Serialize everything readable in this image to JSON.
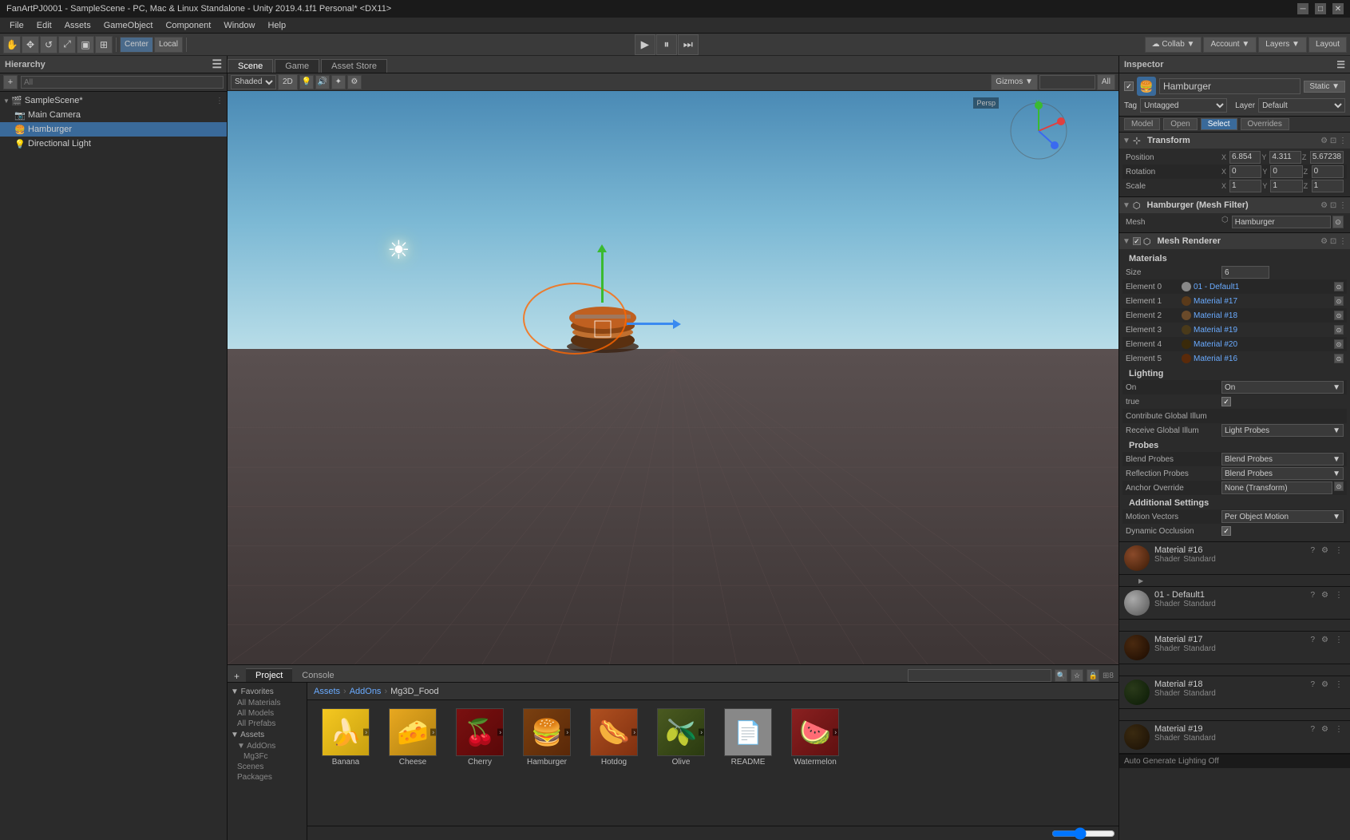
{
  "titleBar": {
    "title": "FanArtPJ0001 - SampleScene - PC, Mac & Linux Standalone - Unity 2019.4.1f1 Personal* <DX11>"
  },
  "menuBar": {
    "items": [
      "File",
      "Edit",
      "Assets",
      "GameObject",
      "Component",
      "Window",
      "Help"
    ]
  },
  "topToolbar": {
    "transformTools": [
      "⬜",
      "✥",
      "↺",
      "⤢",
      "▣",
      "⊞"
    ],
    "centerLocal": [
      "Center",
      "Local"
    ],
    "playPause": [
      "▶",
      "⏸",
      "⏭"
    ],
    "collab": "Collab ▼",
    "account": "Account ▼",
    "layers": "Layers ▼",
    "layout": "Layout"
  },
  "hierarchy": {
    "title": "Hierarchy",
    "searchPlaceholder": "All",
    "scene": "SampleScene*",
    "items": [
      {
        "label": "Main Camera",
        "depth": 1,
        "icon": "camera"
      },
      {
        "label": "Hamburger",
        "depth": 1,
        "icon": "mesh",
        "selected": true
      },
      {
        "label": "Directional Light",
        "depth": 1,
        "icon": "light"
      }
    ]
  },
  "sceneView": {
    "tabs": [
      "Scene",
      "Game",
      "Asset Store"
    ],
    "activeTab": "Scene",
    "shading": "Shaded",
    "gizmos": "Gizmos ▼",
    "allTag": "All"
  },
  "inspector": {
    "title": "Inspector",
    "objectName": "Hamburger",
    "staticLabel": "Static ▼",
    "tagLabel": "Tag",
    "tagValue": "Untagged",
    "layerLabel": "Layer",
    "layerValue": "Default",
    "tabs": [
      "Model",
      "Open",
      "Select",
      "Overrides"
    ],
    "transform": {
      "title": "Transform",
      "position": {
        "x": "6.854",
        "y": "4.311",
        "z": "5.67238"
      },
      "rotation": {
        "x": "0",
        "y": "0",
        "z": "0"
      },
      "scale": {
        "x": "1",
        "y": "1",
        "z": "1"
      }
    },
    "meshFilter": {
      "title": "Hamburger (Mesh Filter)",
      "meshLabel": "Mesh",
      "meshValue": "Hamburger"
    },
    "meshRenderer": {
      "title": "Mesh Renderer",
      "materialsSection": "Materials",
      "sizeLabel": "Size",
      "sizeValue": "6",
      "elements": [
        {
          "label": "Element 0",
          "name": "01 - Default1",
          "color": "#888"
        },
        {
          "label": "Element 1",
          "name": "Material #17",
          "color": "#5a3a1a"
        },
        {
          "label": "Element 2",
          "name": "Material #18",
          "color": "#6a4a2a"
        },
        {
          "label": "Element 3",
          "name": "Material #19",
          "color": "#4a3a1a"
        },
        {
          "label": "Element 4",
          "name": "Material #20",
          "color": "#3a2a0a"
        },
        {
          "label": "Element 5",
          "name": "Material #16",
          "color": "#5a2a0a"
        }
      ],
      "lightingSection": "Lighting",
      "castShadows": "On",
      "receiveShadows": true,
      "contributeGI": "Contribute Global Illum",
      "receiveGI": "Receive Global Illum",
      "receiveGIValue": "Light Probes",
      "probesSection": "Probes",
      "lightProbes": "Blend Probes",
      "reflectionProbes": "Blend Probes",
      "anchorOverride": "None (Transform)",
      "additionalSection": "Additional Settings",
      "motionVectors": "Motion Vectors",
      "motionVectorsValue": "Per Object Motion",
      "dynamicOcclusion": "Dynamic Occlusion"
    }
  },
  "bottomPanel": {
    "tabs": [
      "Project",
      "Console"
    ],
    "activeTab": "Project",
    "breadcrumb": [
      "Assets",
      "AddOns",
      "Mg3D_Food"
    ],
    "searchPlaceholder": "",
    "favorites": {
      "title": "Favorites",
      "items": [
        "All Materials",
        "All Models",
        "All Prefabs"
      ]
    },
    "assetsTree": {
      "title": "Assets",
      "items": [
        "AddOns",
        "Mg3Fc",
        "Scenes",
        "Packages"
      ]
    },
    "gridItems": [
      {
        "name": "Banana",
        "color": "#f5d020",
        "type": "model"
      },
      {
        "name": "Cheese",
        "color": "#f0b040",
        "type": "model"
      },
      {
        "name": "Cherry",
        "color": "#8b0000",
        "type": "model"
      },
      {
        "name": "Hamburger",
        "color": "#8b4513",
        "type": "model"
      },
      {
        "name": "Hotdog",
        "color": "#c06020",
        "type": "model"
      },
      {
        "name": "Olive",
        "color": "#556b2f",
        "type": "model"
      },
      {
        "name": "README",
        "color": "#888",
        "type": "text"
      },
      {
        "name": "Watermelon",
        "color": "#c03030",
        "type": "model"
      }
    ]
  },
  "materialCards": [
    {
      "name": "Material #16",
      "shader": "Standard",
      "color": "#5a2a0a"
    },
    {
      "name": "01 - Default1",
      "shader": "Standard",
      "color": "#888"
    },
    {
      "name": "Material #17",
      "shader": "Standard",
      "color": "#3a1a00"
    },
    {
      "name": "Material #18",
      "shader": "Standard",
      "color": "#1a2a0a"
    },
    {
      "name": "Material #19",
      "shader": "Standard",
      "color": "#2a1a00"
    }
  ],
  "statusBar": {
    "autoGenerate": "Auto Generate Lighting Off"
  }
}
